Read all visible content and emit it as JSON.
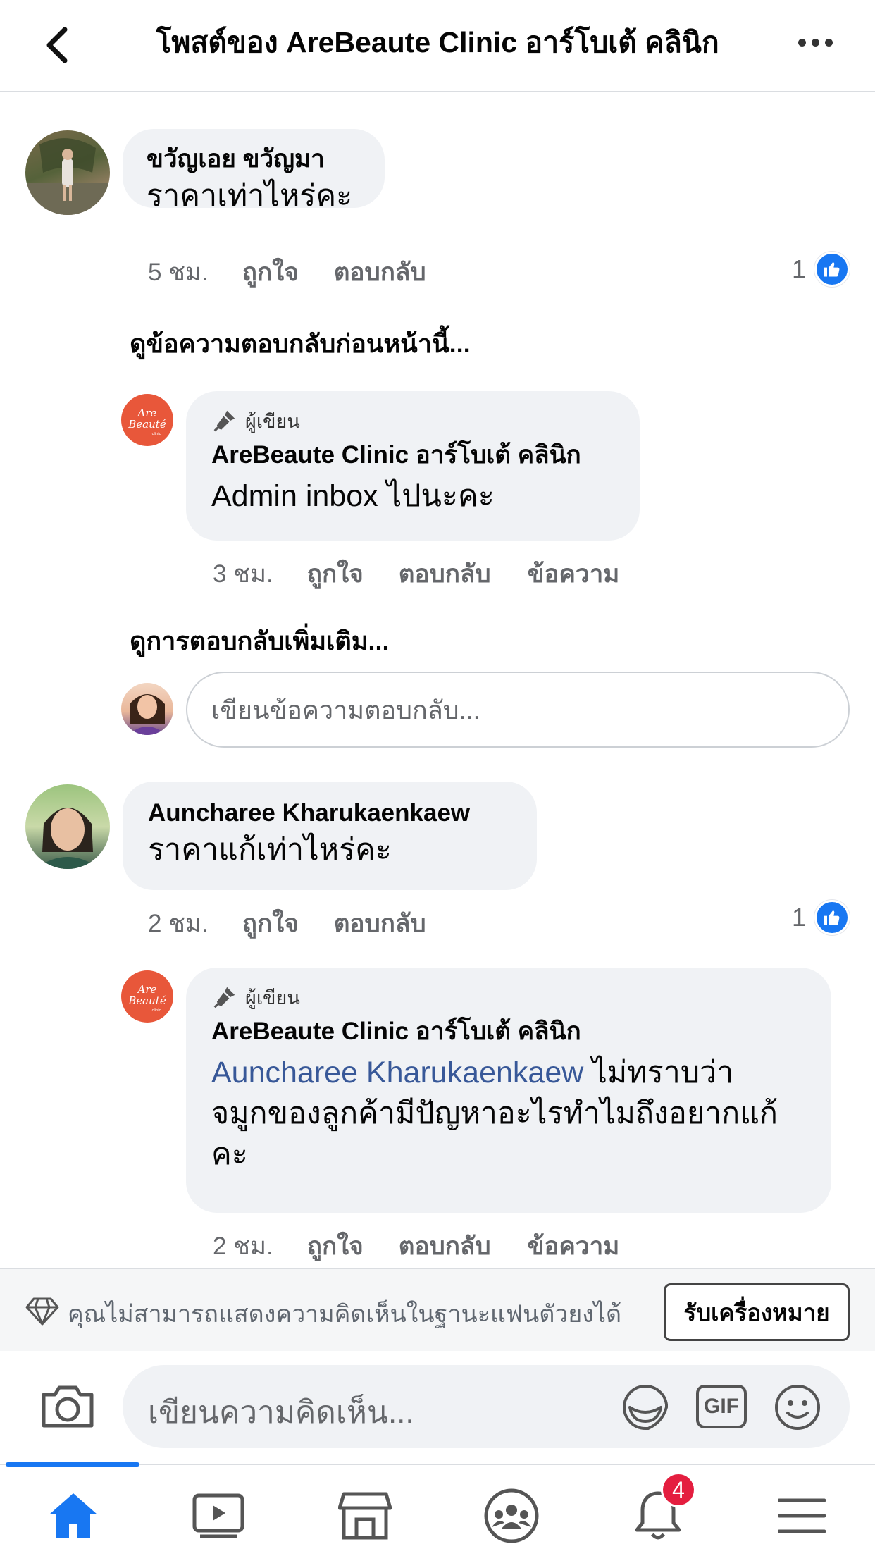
{
  "header": {
    "title": "โพสต์ของ AreBeaute Clinic อาร์โบเต้ คลินิก"
  },
  "comments": [
    {
      "author": "ขวัญเอย ขวัญมา",
      "text": "ราคาเท่าไหร่คะ",
      "time": "5 ชม.",
      "like_label": "ถูกใจ",
      "reply_label": "ตอบกลับ",
      "like_count": "1"
    },
    {
      "author": "Auncharee Kharukaenkaew",
      "text": "ราคาแก้เท่าไหร่คะ",
      "time": "2 ชม.",
      "like_label": "ถูกใจ",
      "reply_label": "ตอบกลับ",
      "like_count": "1"
    }
  ],
  "view_previous_replies": "ดูข้อความตอบกลับก่อนหน้านี้...",
  "view_more_replies": "ดูการตอบกลับเพิ่มเติม...",
  "replies": [
    {
      "author_badge": "ผู้เขียน",
      "author": "AreBeaute Clinic อาร์โบเต้ คลินิก",
      "text": "Admin inbox ไปนะคะ",
      "time": "3 ชม.",
      "like_label": "ถูกใจ",
      "reply_label": "ตอบกลับ",
      "message_label": "ข้อความ"
    },
    {
      "author_badge": "ผู้เขียน",
      "author": "AreBeaute Clinic อาร์โบเต้ คลินิก",
      "mention": "Auncharee Kharukaenkaew",
      "text_line1": " ไม่ทราบว่า",
      "text_line2": "จมูกของลูกค้ามีปัญหาอะไรทำไมถึงอยากแก้",
      "text_line3": "คะ",
      "time": "2 ชม.",
      "like_label": "ถูกใจ",
      "reply_label": "ตอบกลับ",
      "message_label": "ข้อความ"
    }
  ],
  "reply_input": {
    "placeholder": "เขียนข้อความตอบกลับ..."
  },
  "notice": {
    "message": "คุณไม่สามารถแสดงความคิดเห็นในฐานะแฟนตัวยงได้",
    "follow_button": "รับเครื่องหมาย"
  },
  "composer": {
    "placeholder": "เขียนความคิดเห็น...",
    "gif_label": "GIF"
  },
  "tabbar": {
    "notifications_count": "4",
    "items": [
      "home-icon",
      "watch-icon",
      "marketplace-icon",
      "groups-icon",
      "notifications-icon",
      "menu-icon"
    ]
  },
  "colors": {
    "accent": "#1877f2",
    "bubble": "#f0f2f5",
    "clinic_logo": "#e8573a",
    "badge": "#e41e3f"
  }
}
